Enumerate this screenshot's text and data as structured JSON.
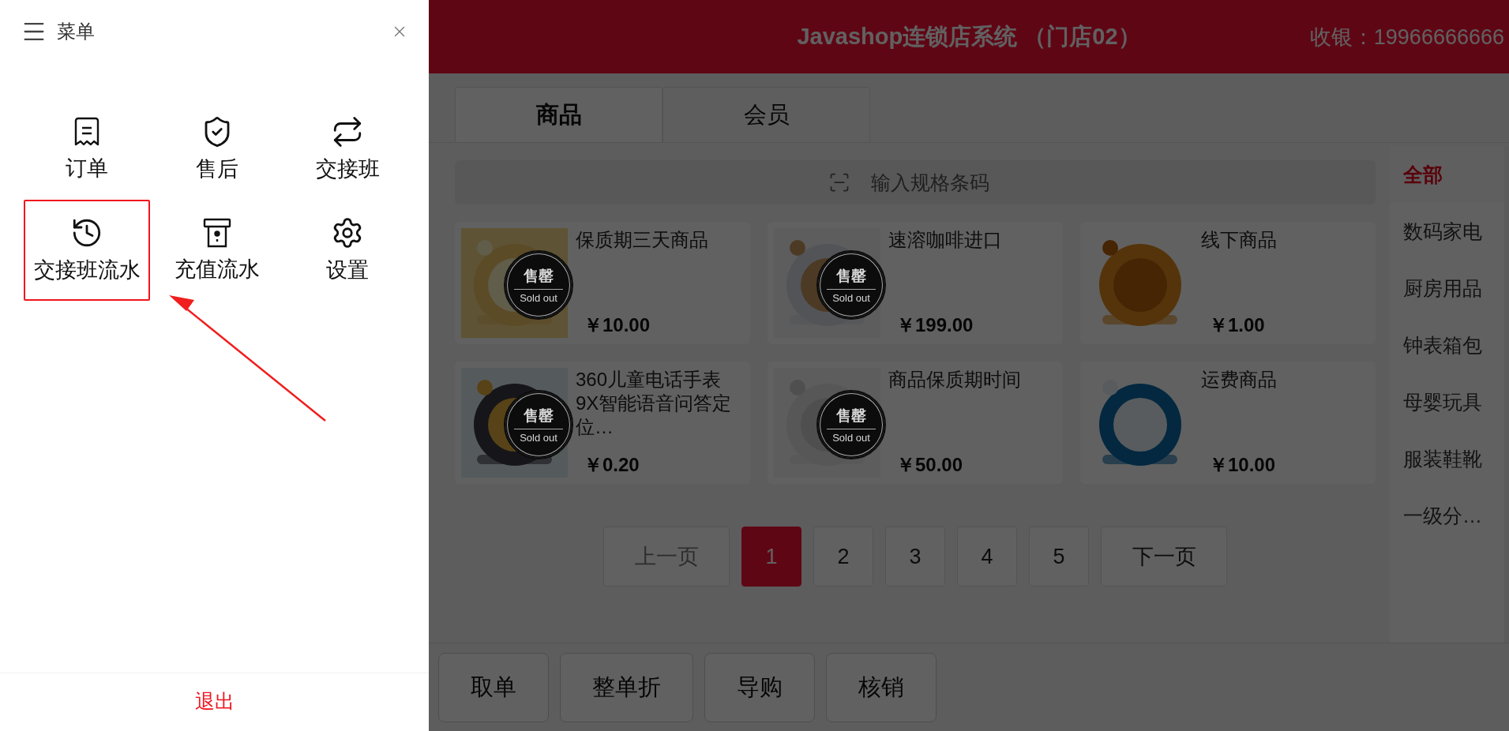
{
  "drawer": {
    "title": "菜单",
    "items": [
      {
        "label": "订单",
        "kind": "receipt",
        "highlighted": false
      },
      {
        "label": "售后",
        "kind": "shield",
        "highlighted": false
      },
      {
        "label": "交接班",
        "kind": "swap",
        "highlighted": false
      },
      {
        "label": "交接班流水",
        "kind": "history",
        "highlighted": true
      },
      {
        "label": "充值流水",
        "kind": "device",
        "highlighted": false
      },
      {
        "label": "设置",
        "kind": "settings",
        "highlighted": false
      }
    ],
    "logout": "退出"
  },
  "header": {
    "title": "Javashop连锁店系统 （门店02）",
    "cashier": "收银：19966666666"
  },
  "tabs": [
    {
      "label": "商品",
      "selected": true
    },
    {
      "label": "会员",
      "selected": false
    }
  ],
  "search": {
    "placeholder": "输入规格条码"
  },
  "products": [
    {
      "name": "保质期三天商品",
      "price": "￥10.00",
      "sold_out": true,
      "badge_cn": "售罄",
      "badge_en": "Sold out"
    },
    {
      "name": "速溶咖啡进口",
      "price": "￥199.00",
      "sold_out": true,
      "badge_cn": "售罄",
      "badge_en": "Sold out"
    },
    {
      "name": "线下商品",
      "price": "￥1.00",
      "sold_out": false
    },
    {
      "name": "360儿童电话手表9X智能语音问答定位…",
      "price": "￥0.20",
      "sold_out": true,
      "badge_cn": "售罄",
      "badge_en": "Sold out"
    },
    {
      "name": "商品保质期时间",
      "price": "￥50.00",
      "sold_out": true,
      "badge_cn": "售罄",
      "badge_en": "Sold out"
    },
    {
      "name": "运费商品",
      "price": "￥10.00",
      "sold_out": false
    }
  ],
  "pagination": {
    "prev": "上一页",
    "prev_disabled": true,
    "next": "下一页",
    "pages": [
      {
        "label": "1",
        "selected": true
      },
      {
        "label": "2",
        "selected": false
      },
      {
        "label": "3",
        "selected": false
      },
      {
        "label": "4",
        "selected": false
      },
      {
        "label": "5",
        "selected": false
      }
    ]
  },
  "categories": [
    {
      "label": "全部",
      "selected": true
    },
    {
      "label": "数码家电",
      "selected": false
    },
    {
      "label": "厨房用品",
      "selected": false
    },
    {
      "label": "钟表箱包",
      "selected": false
    },
    {
      "label": "母婴玩具",
      "selected": false
    },
    {
      "label": "服装鞋靴",
      "selected": false
    },
    {
      "label": "一级分…",
      "selected": false
    }
  ],
  "actions": [
    "取单",
    "整单折",
    "导购",
    "核销"
  ]
}
